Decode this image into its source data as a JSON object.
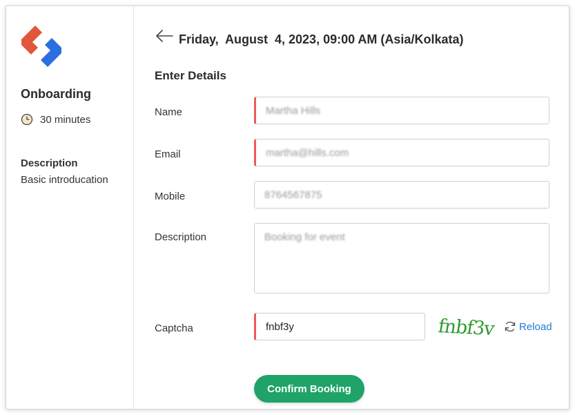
{
  "sidebar": {
    "event_title": "Onboarding",
    "duration": "30 minutes",
    "description_heading": "Description",
    "description_text": "Basic introducation",
    "logo_colors": {
      "top": "#e0573b",
      "bottom": "#2a6fe0"
    }
  },
  "header": {
    "date_time": "Friday,  August  4, 2023, 09:00 AM (Asia/Kolkata)",
    "back_icon": "arrow-left-icon"
  },
  "form": {
    "section_title": "Enter Details",
    "fields": {
      "name": {
        "label": "Name",
        "value": "Martha Hills"
      },
      "email": {
        "label": "Email",
        "value": "martha@hills.com"
      },
      "mobile": {
        "label": "Mobile",
        "value": "8764567875"
      },
      "description": {
        "label": "Description",
        "value": "Booking for event"
      },
      "captcha": {
        "label": "Captcha",
        "value": "fnbf3y",
        "image_text": "fnbf3v"
      }
    },
    "reload_label": "Reload",
    "confirm_label": "Confirm Booking",
    "colors": {
      "required_marker": "#ee5a5a",
      "confirm": "#1fa368",
      "link": "#1e7bd6",
      "captcha_text": "#2e9b2e"
    }
  }
}
